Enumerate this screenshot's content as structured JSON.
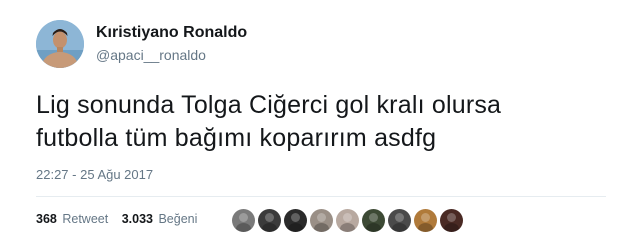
{
  "user": {
    "display_name": "Kıristiyano Ronaldo",
    "handle": "@apaci__ronaldo",
    "avatar_icon": "profile-photo"
  },
  "tweet": {
    "text_lines": [
      "Lig sonunda Tolga Ciğerci gol kralı olursa",
      "futbolla tüm bağımı koparırım asdfg"
    ],
    "timestamp": "22:27 - 25 Ağu 2017"
  },
  "stats": {
    "retweets_count": "368",
    "retweets_label": "Retweet",
    "likes_count": "3.033",
    "likes_label": "Beğeni"
  },
  "likers": {
    "avatar_colors": [
      "#7a7a7a",
      "#3b3b3b",
      "#2b2b2b",
      "#9a8f86",
      "#b8a9a0",
      "#3d4a35",
      "#4a4a4a",
      "#b07a3a",
      "#4a2a24"
    ]
  },
  "colors": {
    "text": "#14171a",
    "secondary": "#657786",
    "divider": "#e6ecf0"
  }
}
